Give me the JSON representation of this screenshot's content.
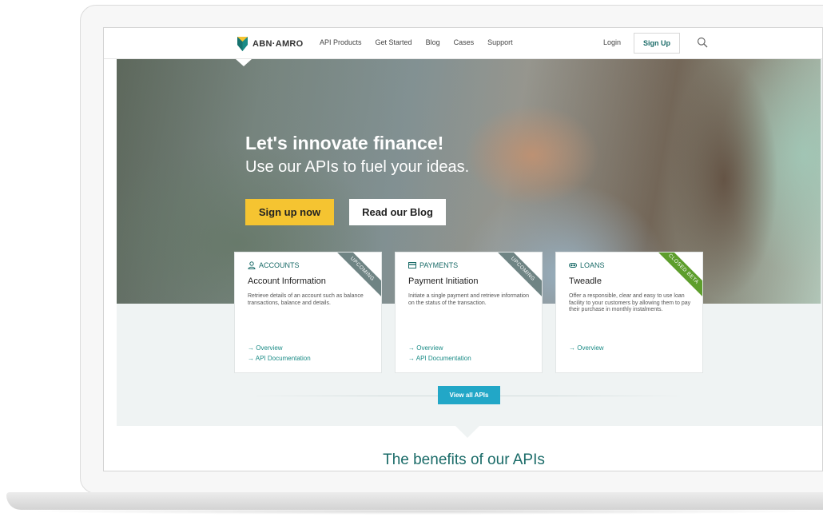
{
  "nav": {
    "logo_text": "ABN·AMRO",
    "links": [
      "API Products",
      "Get Started",
      "Blog",
      "Cases",
      "Support"
    ],
    "login": "Login",
    "signup": "Sign Up"
  },
  "hero": {
    "title": "Let's innovate finance!",
    "subtitle": "Use our APIs to fuel your ideas.",
    "primary_button": "Sign up now",
    "secondary_button": "Read our Blog"
  },
  "cards": [
    {
      "category": "ACCOUNTS",
      "category_icon": "user-icon",
      "title": "Account Information",
      "description": "Retrieve details of an account such as balance transactions, balance and details.",
      "ribbon": "UPCOMING",
      "links": [
        "→ Overview",
        "→ API Documentation"
      ]
    },
    {
      "category": "PAYMENTS",
      "category_icon": "credit-card-icon",
      "title": "Payment Initiation",
      "description": "Initiate a single payment and retrieve information on the status of the transaction.",
      "ribbon": "UPCOMING",
      "links": [
        "→ Overview",
        "→ API Documentation"
      ]
    },
    {
      "category": "LOANS",
      "category_icon": "loan-icon",
      "title": "Tweadle",
      "description": "Offer a responsible, clear and easy to use loan facility to your customers by allowing them to pay their purchase in monthly instalments.",
      "ribbon": "CLOSED BETA",
      "links": [
        "→ Overview"
      ]
    }
  ],
  "view_all": "View all APIs",
  "benefits_title": "The benefits of our APIs",
  "colors": {
    "brand_teal": "#1a6b68",
    "brand_yellow": "#f5c431",
    "cta_blue": "#22a7c7",
    "ribbon_grey": "#6f8484",
    "ribbon_green": "#5d9e2c"
  }
}
